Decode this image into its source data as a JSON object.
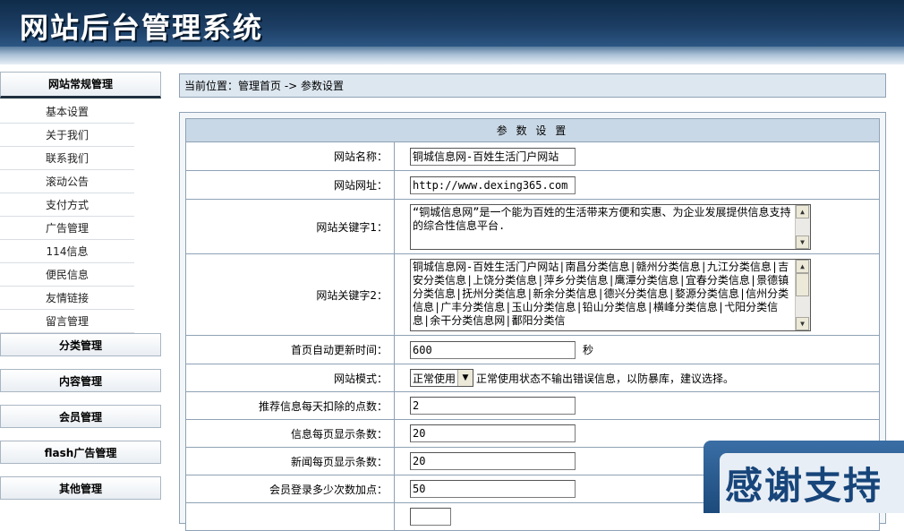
{
  "header": {
    "title": "网站后台管理系统"
  },
  "sidebar": {
    "sections": [
      {
        "label": "网站常规管理",
        "open": true,
        "items": [
          "基本设置",
          "关于我们",
          "联系我们",
          "滚动公告",
          "支付方式",
          "广告管理",
          "114信息",
          "便民信息",
          "友情链接",
          "留言管理"
        ]
      },
      {
        "label": "分类管理"
      },
      {
        "label": "内容管理"
      },
      {
        "label": "会员管理"
      },
      {
        "label": "flash广告管理"
      },
      {
        "label": "其他管理"
      }
    ]
  },
  "breadcrumb": "当前位置：管理首页 -> 参数设置",
  "panel": {
    "title": "参 数 设 置",
    "site_name": {
      "label": "网站名称：",
      "value": "铜城信息网-百姓生活门户网站"
    },
    "site_url": {
      "label": "网站网址：",
      "value": "http://www.dexing365.com"
    },
    "keyword1": {
      "label": "网站关键字1：",
      "value": "“铜城信息网”是一个能为百姓的生活带来方便和实惠、为企业发展提供信息支持的综合性信息平台."
    },
    "keyword2": {
      "label": "网站关键字2：",
      "value": "铜城信息网-百姓生活门户网站|南昌分类信息|赣州分类信息|九江分类信息|吉安分类信息|上饶分类信息|萍乡分类信息|鹰潭分类信息|宜春分类信息|景德镇分类信息|抚州分类信息|新余分类信息|德兴分类信息|婺源分类信息|信州分类信息|广丰分类信息|玉山分类信息|铅山分类信息|横峰分类信息|弋阳分类信息|余干分类信息网|鄱阳分类信"
    },
    "refresh": {
      "label": "首页自动更新时间：",
      "value": "600",
      "unit": "秒"
    },
    "mode": {
      "label": "网站模式：",
      "value": "正常使用",
      "note": "正常使用状态不输出错误信息，以防暴库，建议选择。"
    },
    "points": {
      "label": "推荐信息每天扣除的点数：",
      "value": "2"
    },
    "info_per_page": {
      "label": "信息每页显示条数：",
      "value": "20"
    },
    "news_per_page": {
      "label": "新闻每页显示条数：",
      "value": "20"
    },
    "login_points": {
      "label": "会员登录多少次数加点：",
      "value": "50"
    }
  },
  "badge": {
    "text": "感谢支持"
  }
}
